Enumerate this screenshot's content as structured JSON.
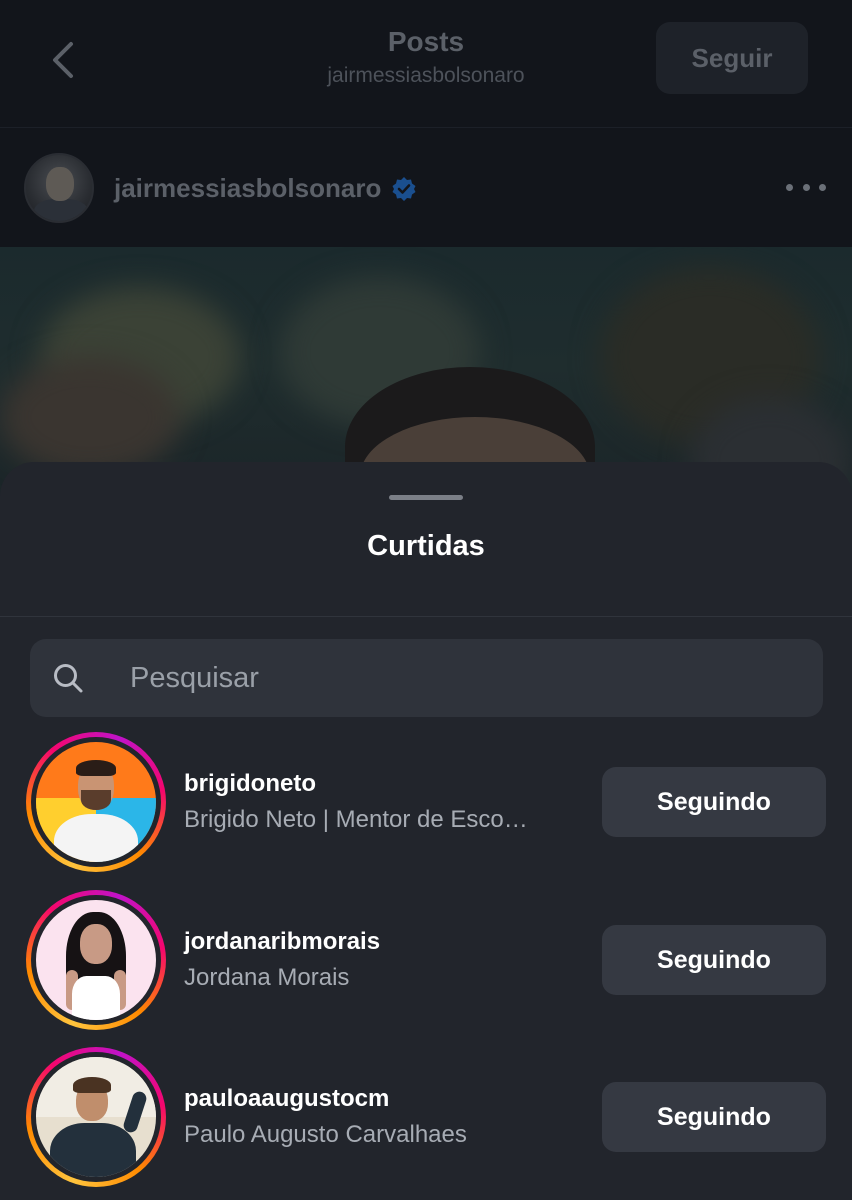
{
  "header": {
    "title": "Posts",
    "subtitle": "jairmessiasbolsonaro",
    "follow_label": "Seguir"
  },
  "post": {
    "username": "jairmessiasbolsonaro",
    "verified": true
  },
  "sheet": {
    "title": "Curtidas",
    "search_placeholder": "Pesquisar"
  },
  "likes": [
    {
      "username": "brigidoneto",
      "full_name": "Brigido Neto | Mentor de Esco…",
      "button": "Seguindo"
    },
    {
      "username": "jordanaribmorais",
      "full_name": "Jordana Morais",
      "button": "Seguindo"
    },
    {
      "username": "pauloaaugustocm",
      "full_name": "Paulo Augusto Carvalhaes",
      "button": "Seguindo"
    }
  ],
  "colors": {
    "sheet_bg": "#22252c",
    "button_bg": "#353942",
    "verified_blue": "#1d6fd1",
    "story_ring": [
      "#ffc43d",
      "#ff8a00",
      "#f5066d",
      "#c013c9"
    ]
  }
}
